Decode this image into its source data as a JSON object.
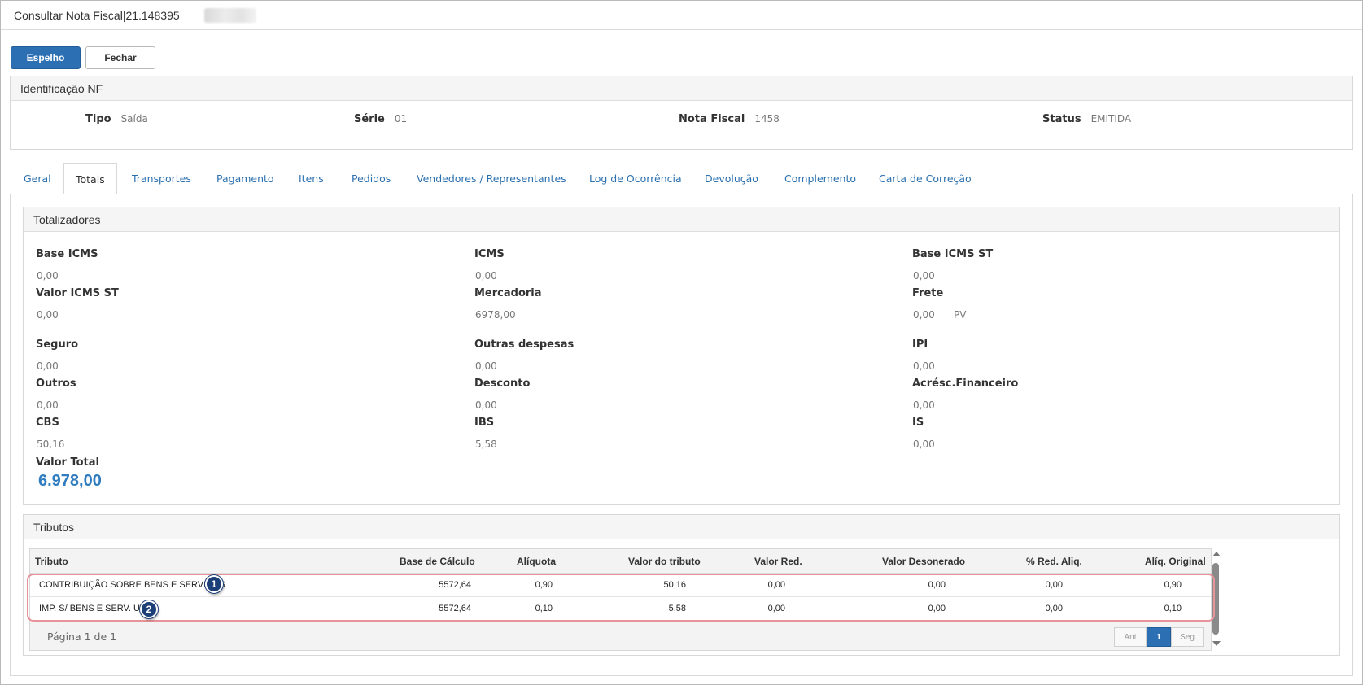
{
  "window": {
    "title": "Consultar Nota Fiscal|21.148395"
  },
  "toolbar": {
    "espelho_label": "Espelho",
    "fechar_label": "Fechar"
  },
  "identificacao": {
    "header": "Identificação NF",
    "tipo_label": "Tipo",
    "tipo_value": "Saída",
    "serie_label": "Série",
    "serie_value": "01",
    "nota_label": "Nota Fiscal",
    "nota_value": "1458",
    "status_label": "Status",
    "status_value": "EMITIDA"
  },
  "tabs": [
    {
      "label": "Geral"
    },
    {
      "label": "Totais",
      "active": true
    },
    {
      "label": "Transportes"
    },
    {
      "label": "Pagamento"
    },
    {
      "label": "Itens"
    },
    {
      "label": "Pedidos"
    },
    {
      "label": "Vendedores / Representantes"
    },
    {
      "label": "Log de Ocorrência"
    },
    {
      "label": "Devolução"
    },
    {
      "label": "Complemento"
    },
    {
      "label": "Carta de Correção"
    }
  ],
  "totalizadores": {
    "header": "Totalizadores",
    "fields": [
      {
        "label": "Base ICMS",
        "value": "0,00"
      },
      {
        "label": "ICMS",
        "value": "0,00"
      },
      {
        "label": "Base ICMS ST",
        "value": "0,00"
      },
      {
        "label": "Valor ICMS ST",
        "value": "0,00"
      },
      {
        "label": "Mercadoria",
        "value": "6978,00"
      },
      {
        "label": "Frete",
        "value": "0,00",
        "suffix": "PV"
      },
      {
        "label": "Seguro",
        "value": "0,00"
      },
      {
        "label": "Outras despesas",
        "value": "0,00"
      },
      {
        "label": "IPI",
        "value": "0,00"
      },
      {
        "label": "Outros",
        "value": "0,00"
      },
      {
        "label": "Desconto",
        "value": "0,00"
      },
      {
        "label": "Acrésc.Financeiro",
        "value": "0,00"
      },
      {
        "label": "CBS",
        "value": "50,16"
      },
      {
        "label": "IBS",
        "value": "5,58"
      },
      {
        "label": "IS",
        "value": "0,00"
      }
    ],
    "valor_total_label": "Valor Total",
    "valor_total": "6.978,00"
  },
  "tributos": {
    "header": "Tributos",
    "columns": [
      "Tributo",
      "Base de Cálculo",
      "Alíquota",
      "Valor do tributo",
      "Valor Red.",
      "Valor Desonerado",
      "% Red. Aliq.",
      "Alíq. Original"
    ],
    "rows": [
      {
        "tributo": "CONTRIBUIÇÃO SOBRE BENS E SERVIÇOS",
        "base": "5572,64",
        "aliquota": "0,90",
        "valor": "50,16",
        "red": "0,00",
        "desonerado": "0,00",
        "pct_red": "0,00",
        "original": "0,90",
        "badge": "1"
      },
      {
        "tributo": "IMP. S/ BENS E SERV. UF",
        "base": "5572,64",
        "aliquota": "0,10",
        "valor": "5,58",
        "red": "0,00",
        "desonerado": "0,00",
        "pct_red": "0,00",
        "original": "0,10",
        "badge": "2"
      }
    ],
    "page_info": "Página 1 de 1",
    "pager": {
      "prev": "Ant",
      "current": "1",
      "next": "Seg"
    }
  },
  "colors": {
    "primary": "#2d6fb3",
    "link": "#2a6fae",
    "total": "#2f7cc0",
    "highlight": "#e8939a",
    "badge": "#1d3f78"
  }
}
